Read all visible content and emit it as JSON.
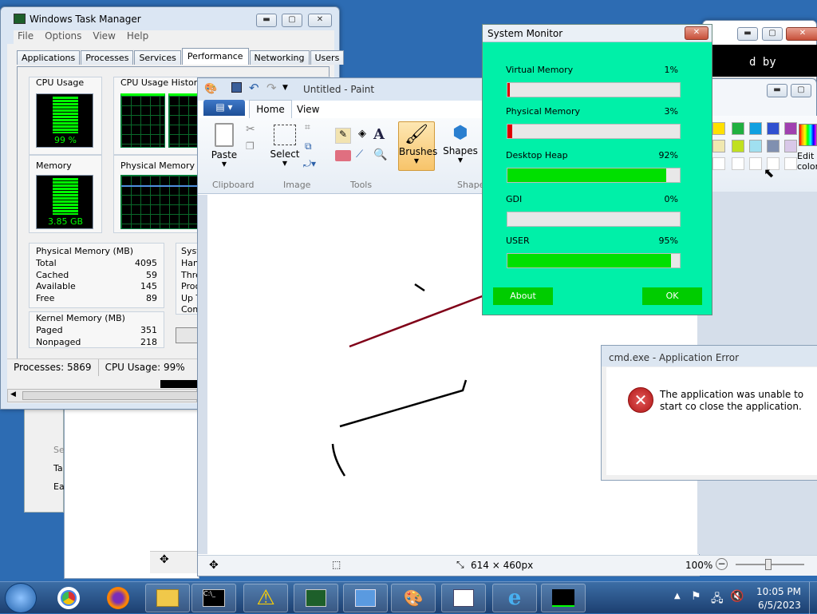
{
  "task_manager": {
    "title": "Windows Task Manager",
    "menu": [
      "File",
      "Options",
      "View",
      "Help"
    ],
    "tabs": [
      "Applications",
      "Processes",
      "Services",
      "Performance",
      "Networking",
      "Users"
    ],
    "active_tab": "Performance",
    "cpu_usage_label": "CPU Usage",
    "cpu_usage_value": "99 %",
    "cpu_history_label": "CPU Usage History",
    "memory_label": "Memory",
    "memory_value": "3.85 GB",
    "physical_memory_usage_label": "Physical Memory Usa",
    "physical_memory": {
      "title": "Physical Memory (MB)",
      "rows": [
        [
          "Total",
          "4095"
        ],
        [
          "Cached",
          "59"
        ],
        [
          "Available",
          "145"
        ],
        [
          "Free",
          "89"
        ]
      ]
    },
    "system": {
      "title": "Syst",
      "rows": [
        "Han",
        "Thre",
        "Proc",
        "Up T",
        "Com"
      ]
    },
    "kernel_memory": {
      "title": "Kernel Memory (MB)",
      "rows": [
        [
          "Paged",
          "351"
        ],
        [
          "Nonpaged",
          "218"
        ]
      ]
    },
    "status_processes": "Processes: 5869",
    "status_cpu": "CPU Usage: 99%"
  },
  "paint": {
    "title": "Untitled - Paint",
    "tabs": [
      "Home",
      "View"
    ],
    "tools": {
      "paste": "Paste",
      "select": "Select",
      "brushes": "Brushes",
      "shapes": "Shapes",
      "edit_colors": "Edit colors"
    },
    "groups": [
      "Clipboard",
      "Image",
      "Tools",
      "Shape"
    ],
    "status_size": "614 × 460px",
    "zoom": "100%"
  },
  "system_monitor": {
    "title": "System Monitor",
    "items": [
      {
        "label": "Virtual Memory",
        "value": "1%",
        "level": 1,
        "color": "#e00000"
      },
      {
        "label": "Physical Memory",
        "value": "3%",
        "level": 3,
        "color": "#e00000"
      },
      {
        "label": "Desktop Heap",
        "value": "92%",
        "level": 92,
        "color": "#00e000"
      },
      {
        "label": "GDI",
        "value": "0%",
        "level": 0,
        "color": "#00e000"
      },
      {
        "label": "USER",
        "value": "95%",
        "level": 95,
        "color": "#00e000"
      }
    ],
    "about_label": "About",
    "ok_label": "OK"
  },
  "error_dialog": {
    "title": "cmd.exe - Application Error",
    "message": "The application was unable to start co close the application."
  },
  "background_window": {
    "text": "d by"
  },
  "behind_labels": [
    "Se",
    "Ta",
    "Ea"
  ],
  "taskbar": {
    "time": "10:05 PM",
    "date": "6/5/2023"
  },
  "colors": {
    "sysmon_bg": "#00f0a8",
    "ok_green": "#00cc00",
    "task_cpu_green": "#00ff00"
  }
}
